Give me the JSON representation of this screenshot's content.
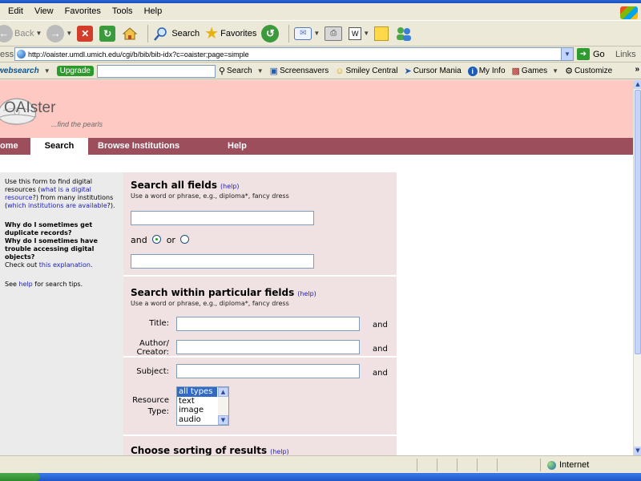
{
  "menu": [
    "Edit",
    "View",
    "Favorites",
    "Tools",
    "Help"
  ],
  "toolbar": {
    "back": "Back",
    "search": "Search",
    "favorites": "Favorites"
  },
  "address": {
    "label": "ess",
    "url": "http://oaister.umdl.umich.edu/cgi/b/bib/bib-idx?c=oaister;page=simple",
    "go": "Go",
    "links": "Links"
  },
  "linksbar": {
    "brand": "websearch",
    "upgrade": "Upgrade",
    "search": "Search",
    "items": [
      "Screensavers",
      "Smiley Central",
      "Cursor Mania",
      "My Info",
      "Games",
      "Customize"
    ]
  },
  "site": {
    "logo": "OAIster",
    "tagline": "...find the pearls",
    "nav": [
      "ome",
      "Search",
      "Browse Institutions",
      "Help"
    ]
  },
  "sidebar": {
    "intro_1": "Use this form to find digital resources (",
    "intro_link_1": "what is a digital resource",
    "intro_2": "?) from many institutions (",
    "intro_link_2": "which institutions are available",
    "intro_3": "?).",
    "q1": "Why do I sometimes get duplicate records?",
    "q2": "Why do I sometimes have trouble accessing digital objects?",
    "check_1": "Check out ",
    "check_link": "this explanation",
    "check_2": ".",
    "see_1": "See ",
    "see_link": "help",
    "see_2": " for search tips."
  },
  "form": {
    "all": {
      "title": "Search all fields",
      "help": "(help)",
      "hint": "Use a word or phrase, e.g., diploma*, fancy dress",
      "and": "and",
      "or": "or"
    },
    "particular": {
      "title": "Search within particular fields",
      "help": "(help)",
      "hint": "Use a word or phrase, e.g., diploma*, fancy dress",
      "title_label": "Title:",
      "author_label_1": "Author/",
      "author_label_2": "Creator:",
      "subject_label": "Subject:",
      "and": "and",
      "resource_label_1": "Resource",
      "resource_label_2": "Type:",
      "resource_options": [
        "all types",
        "text",
        "image",
        "audio"
      ]
    },
    "sorting": {
      "title": "Choose sorting of results",
      "help": "(help)"
    }
  },
  "status": {
    "zone": "Internet"
  }
}
